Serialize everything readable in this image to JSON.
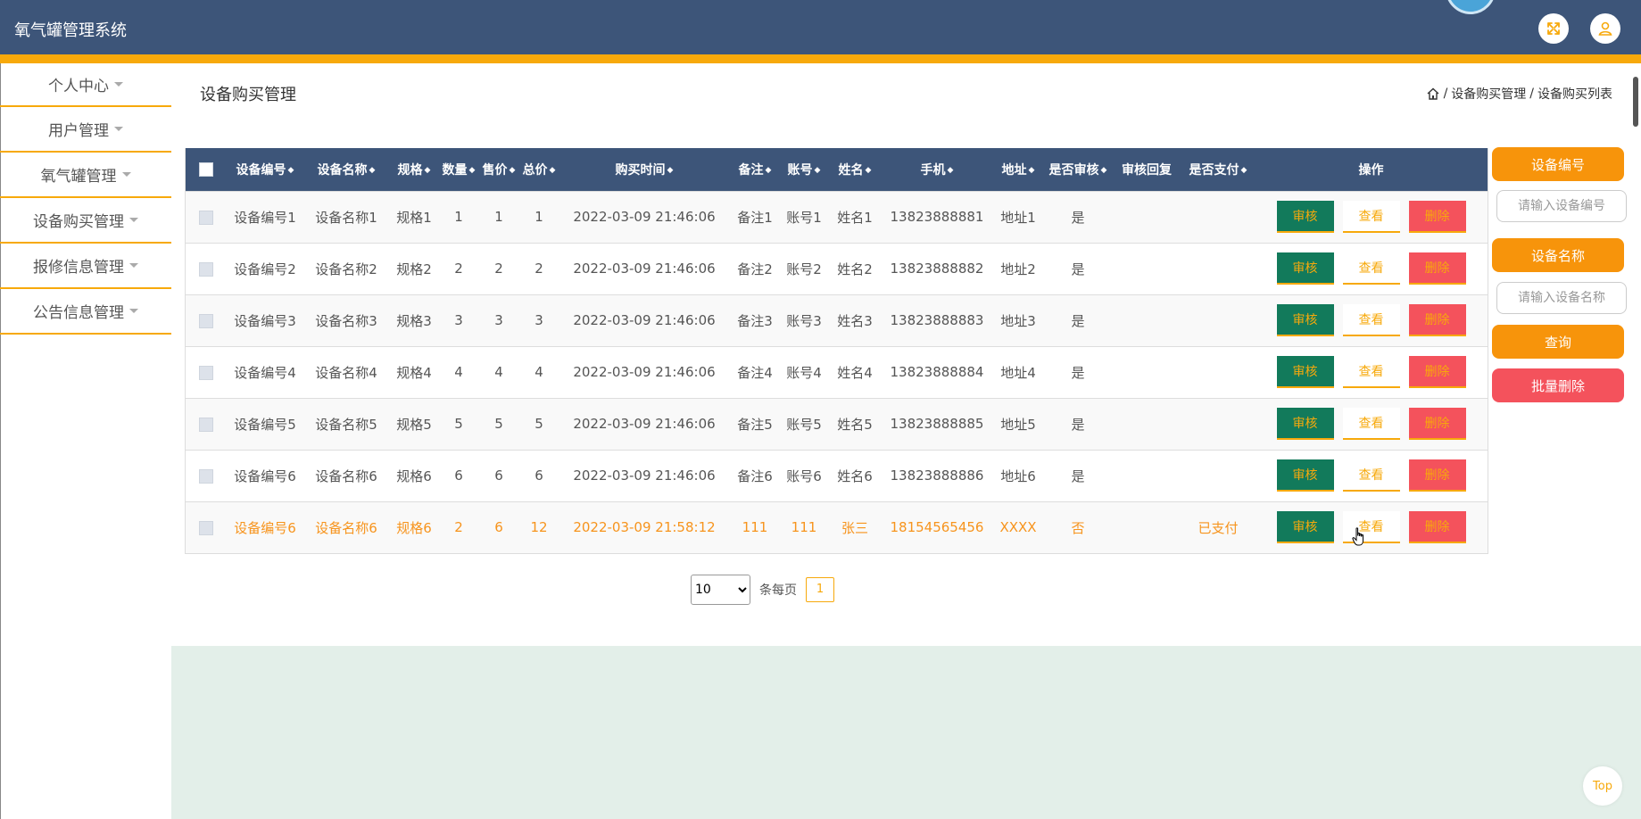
{
  "app": {
    "title": "氧气罐管理系统"
  },
  "header_icons": {
    "fullscreen": "fullscreen-icon",
    "user": "user-icon"
  },
  "colors": {
    "navy": "#3d5579",
    "accent": "#f7a90b",
    "audit": "#127a5b",
    "delete": "#f4525c",
    "footer": "#e3efe9"
  },
  "sidebar": {
    "items": [
      {
        "label": "个人中心"
      },
      {
        "label": "用户管理"
      },
      {
        "label": "氧气罐管理"
      },
      {
        "label": "设备购买管理"
      },
      {
        "label": "报修信息管理"
      },
      {
        "label": "公告信息管理"
      }
    ]
  },
  "page": {
    "title": "设备购买管理"
  },
  "breadcrumb": {
    "home_icon": "home-icon",
    "sep": "/",
    "level1": "设备购买管理",
    "level2": "设备购买列表"
  },
  "table": {
    "columns": [
      "设备编号",
      "设备名称",
      "规格",
      "数量",
      "售价",
      "总价",
      "购买时间",
      "备注",
      "账号",
      "姓名",
      "手机",
      "地址",
      "是否审核",
      "审核回复",
      "是否支付",
      "操作"
    ],
    "sortable": [
      true,
      true,
      true,
      true,
      true,
      true,
      true,
      true,
      true,
      true,
      true,
      true,
      true,
      false,
      true,
      false
    ],
    "rows": [
      [
        "设备编号1",
        "设备名称1",
        "规格1",
        "1",
        "1",
        "1",
        "2022-03-09 21:46:06",
        "备注1",
        "账号1",
        "姓名1",
        "13823888881",
        "地址1",
        "是",
        "",
        ""
      ],
      [
        "设备编号2",
        "设备名称2",
        "规格2",
        "2",
        "2",
        "2",
        "2022-03-09 21:46:06",
        "备注2",
        "账号2",
        "姓名2",
        "13823888882",
        "地址2",
        "是",
        "",
        ""
      ],
      [
        "设备编号3",
        "设备名称3",
        "规格3",
        "3",
        "3",
        "3",
        "2022-03-09 21:46:06",
        "备注3",
        "账号3",
        "姓名3",
        "13823888883",
        "地址3",
        "是",
        "",
        ""
      ],
      [
        "设备编号4",
        "设备名称4",
        "规格4",
        "4",
        "4",
        "4",
        "2022-03-09 21:46:06",
        "备注4",
        "账号4",
        "姓名4",
        "13823888884",
        "地址4",
        "是",
        "",
        ""
      ],
      [
        "设备编号5",
        "设备名称5",
        "规格5",
        "5",
        "5",
        "5",
        "2022-03-09 21:46:06",
        "备注5",
        "账号5",
        "姓名5",
        "13823888885",
        "地址5",
        "是",
        "",
        ""
      ],
      [
        "设备编号6",
        "设备名称6",
        "规格6",
        "6",
        "6",
        "6",
        "2022-03-09 21:46:06",
        "备注6",
        "账号6",
        "姓名6",
        "13823888886",
        "地址6",
        "是",
        "",
        ""
      ],
      [
        "设备编号6",
        "设备名称6",
        "规格6",
        "2",
        "6",
        "12",
        "2022-03-09 21:58:12",
        "111",
        "111",
        "张三",
        "18154565456",
        "XXXX",
        "否",
        "",
        "已支付"
      ]
    ],
    "highlight_row": 6,
    "actions": {
      "audit": "审核",
      "view": "查看",
      "delete": "删除"
    }
  },
  "search": {
    "field1_label": "设备编号",
    "field1_placeholder": "请输入设备编号",
    "field2_label": "设备名称",
    "field2_placeholder": "请输入设备名称",
    "query_button": "查询",
    "batch_delete_button": "批量删除"
  },
  "pagination": {
    "page_size": "10",
    "page_size_options": [
      "10"
    ],
    "per_page_label": "条每页",
    "current_page": "1"
  },
  "top_button": "Top"
}
